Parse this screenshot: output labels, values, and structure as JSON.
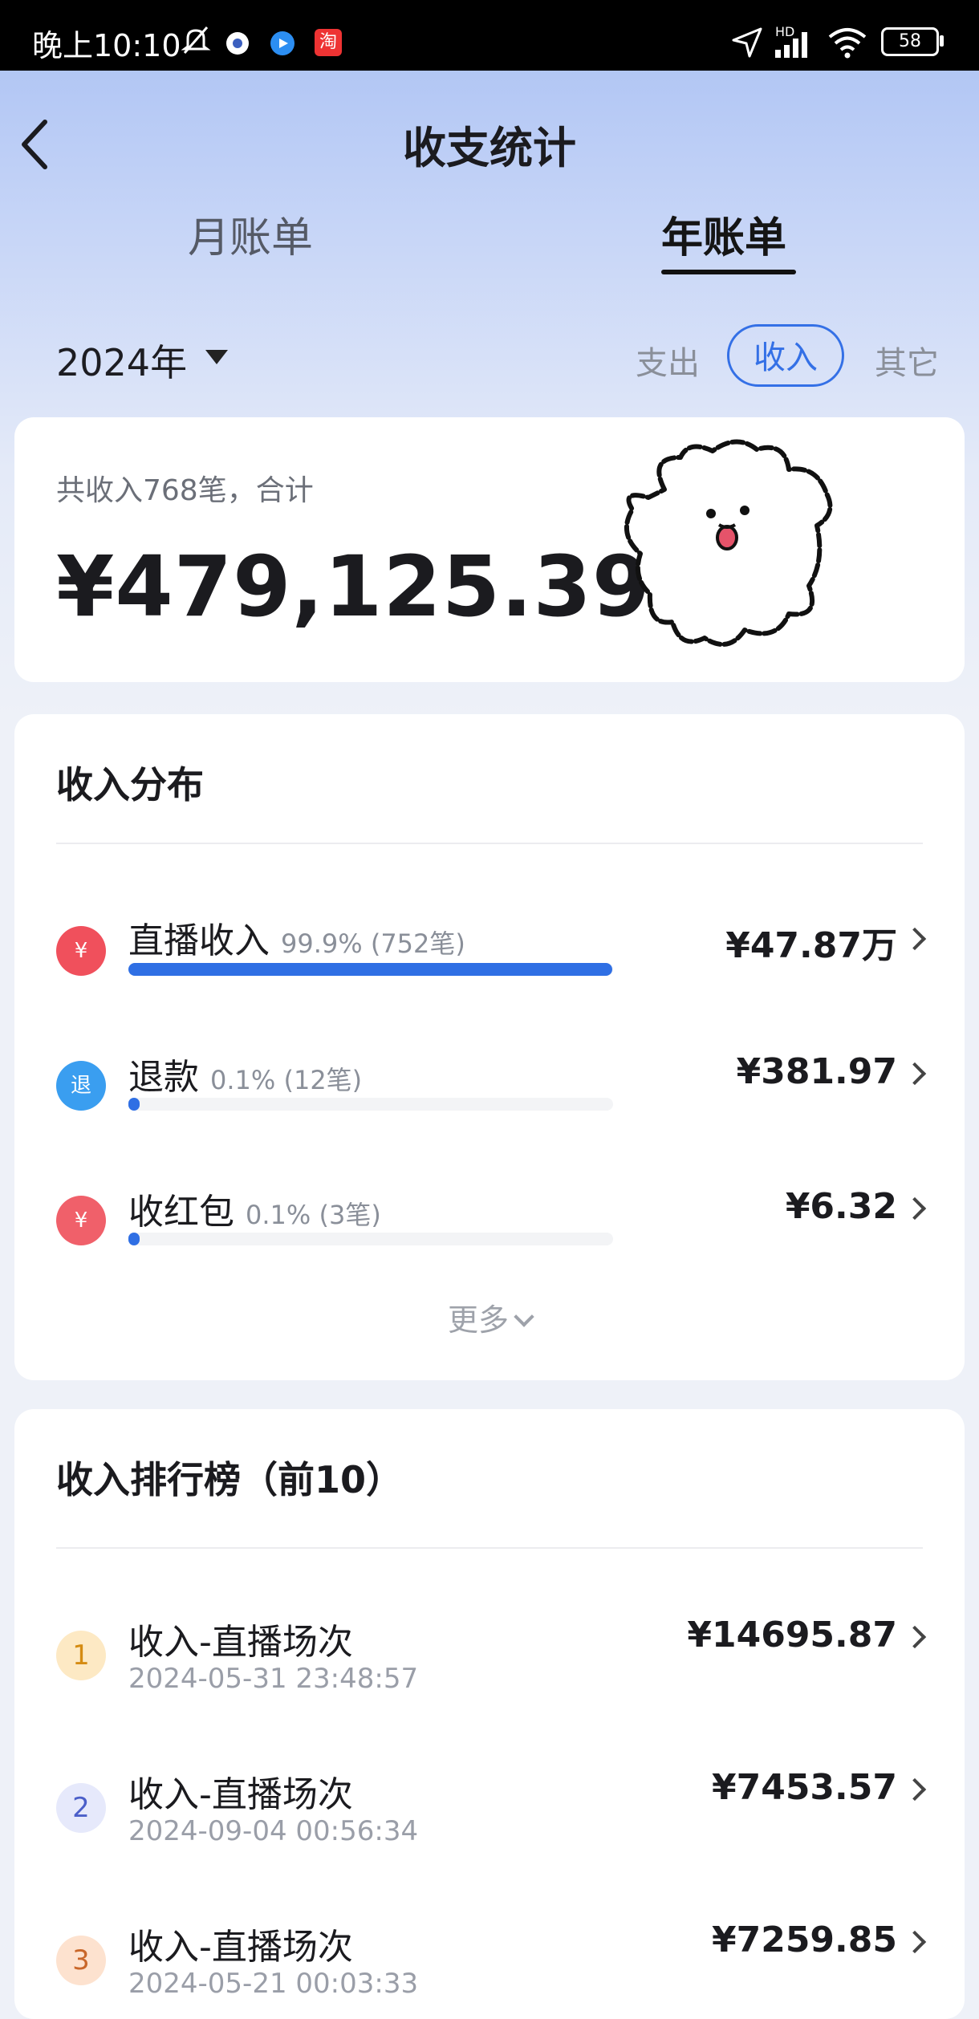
{
  "status_bar": {
    "time": "晚上10:10",
    "signal_label": "HD",
    "battery": "58",
    "app_badge": "淘"
  },
  "header": {
    "title": "收支统计"
  },
  "tabs": [
    {
      "label": "月账单",
      "active": false
    },
    {
      "label": "年账单",
      "active": true
    }
  ],
  "year_selector": {
    "value": "2024年"
  },
  "filters": [
    {
      "label": "支出",
      "active": false
    },
    {
      "label": "收入",
      "active": true
    },
    {
      "label": "其它",
      "active": false
    }
  ],
  "summary": {
    "label": "共收入768笔，合计",
    "amount": "¥479,125.39"
  },
  "distribution": {
    "title": "收入分布",
    "items": [
      {
        "name": "直播收入",
        "meta": "99.9% (752笔)",
        "amount": "¥47.87万",
        "percent": 99.9,
        "icon_text": "¥",
        "icon_color": "#f0505c",
        "icon": "live-income-icon"
      },
      {
        "name": "退款",
        "meta": "0.1% (12笔)",
        "amount": "¥381.97",
        "percent": 0.1,
        "icon_text": "退",
        "icon_color": "#3a9ef0",
        "icon": "refund-icon"
      },
      {
        "name": "收红包",
        "meta": "0.1% (3笔)",
        "amount": "¥6.32",
        "percent": 0.1,
        "icon_text": "¥",
        "icon_color": "#f0606a",
        "icon": "red-packet-icon"
      }
    ],
    "more_label": "更多"
  },
  "ranking": {
    "title": "收入排行榜（前10）",
    "items": [
      {
        "rank": "1",
        "name": "收入-直播场次",
        "time": "2024-05-31 23:48:57",
        "amount": "¥14695.87",
        "badge_bg": "#fde9c4",
        "badge_fg": "#d58b12"
      },
      {
        "rank": "2",
        "name": "收入-直播场次",
        "time": "2024-09-04 00:56:34",
        "amount": "¥7453.57",
        "badge_bg": "#e6e9fb",
        "badge_fg": "#4b5fc9"
      },
      {
        "rank": "3",
        "name": "收入-直播场次",
        "time": "2024-05-21 00:03:33",
        "amount": "¥7259.85",
        "badge_bg": "#fde2cf",
        "badge_fg": "#c9672a"
      }
    ]
  },
  "colors": {
    "accent": "#3470e6",
    "bar": "#2f6fe4"
  }
}
